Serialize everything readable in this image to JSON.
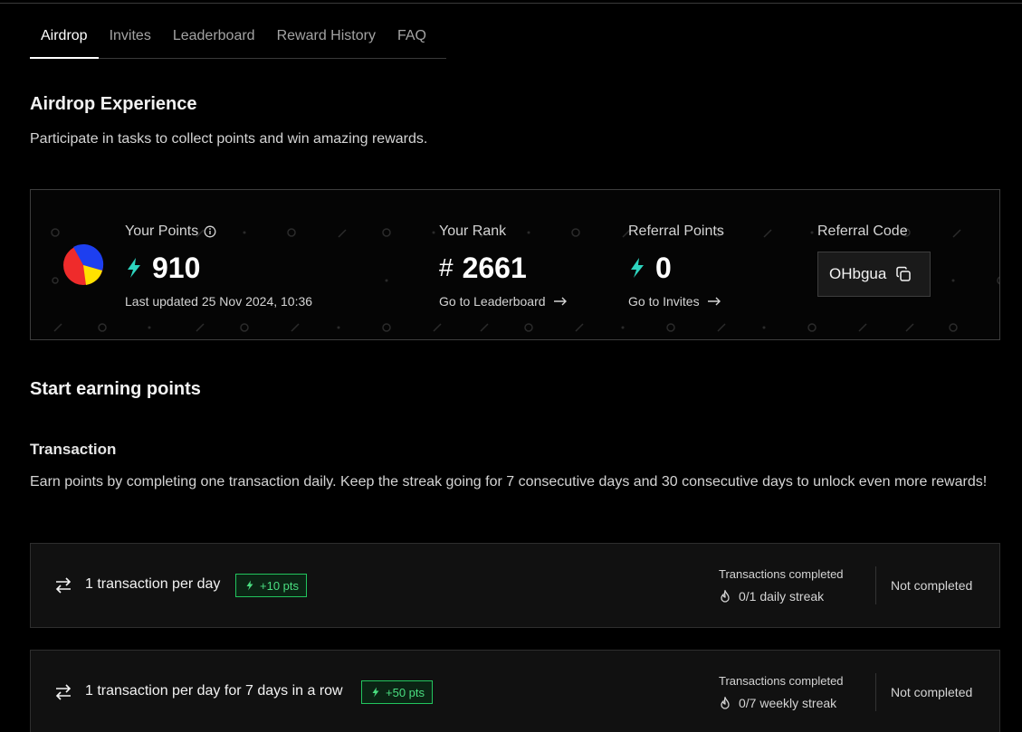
{
  "tabs": [
    {
      "label": "Airdrop",
      "active": true
    },
    {
      "label": "Invites",
      "active": false
    },
    {
      "label": "Leaderboard",
      "active": false
    },
    {
      "label": "Reward History",
      "active": false
    },
    {
      "label": "FAQ",
      "active": false
    }
  ],
  "header": {
    "title": "Airdrop Experience",
    "subtitle": "Participate in tasks to collect points and win amazing rewards."
  },
  "stats": {
    "points": {
      "label": "Your Points",
      "value": "910",
      "updated": "Last updated 25 Nov 2024, 10:36"
    },
    "rank": {
      "label": "Your Rank",
      "hash": "#",
      "value": "2661",
      "link": "Go to Leaderboard"
    },
    "referral_points": {
      "label": "Referral Points",
      "value": "0",
      "link": "Go to Invites"
    },
    "referral_code": {
      "label": "Referral Code",
      "value": "OHbgua"
    }
  },
  "earn": {
    "title": "Start earning points",
    "section_title": "Transaction",
    "description": "Earn points by completing one transaction daily. Keep the streak going for 7 consecutive days and 30 consecutive days to unlock even more rewards!"
  },
  "tasks": [
    {
      "title": "1 transaction per day",
      "points": "+10 pts",
      "status_label": "Transactions completed",
      "streak": "0/1 daily streak",
      "state": "Not completed"
    },
    {
      "title": "1 transaction per day for 7 days in a row",
      "points": "+50 pts",
      "status_label": "Transactions completed",
      "streak": "0/7 weekly streak",
      "state": "Not completed"
    }
  ],
  "colors": {
    "accent_green": "#22c55e",
    "bolt_teal": "#2dd4bf",
    "background": "#000000"
  },
  "icons": {
    "bolt": "lightning-bolt-icon",
    "info": "info-icon",
    "arrow": "arrow-right-icon",
    "copy": "copy-icon",
    "swap": "swap-arrows-icon",
    "flame": "flame-icon"
  }
}
